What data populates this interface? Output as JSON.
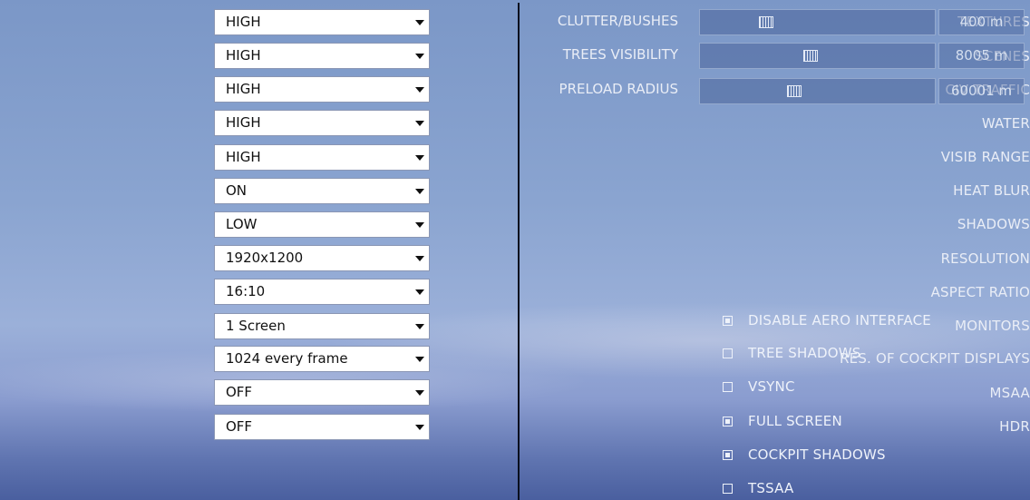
{
  "settings": [
    {
      "label": "TEXTURES",
      "value": "HIGH"
    },
    {
      "label": "SCENES",
      "value": "HIGH"
    },
    {
      "label": "CIV TRAFFIC",
      "value": "HIGH"
    },
    {
      "label": "WATER",
      "value": "HIGH"
    },
    {
      "label": "VISIB RANGE",
      "value": "HIGH"
    },
    {
      "label": "HEAT BLUR",
      "value": "ON"
    },
    {
      "label": "SHADOWS",
      "value": "LOW"
    },
    {
      "label": "RESOLUTION",
      "value": "1920x1200"
    },
    {
      "label": "ASPECT RATIO",
      "value": "16:10"
    },
    {
      "label": "MONITORS",
      "value": "1 Screen"
    },
    {
      "label": "RES. OF COCKPIT DISPLAYS",
      "value": "1024 every frame"
    },
    {
      "label": "MSAA",
      "value": "OFF"
    },
    {
      "label": "HDR",
      "value": "OFF"
    }
  ],
  "sliders": [
    {
      "label": "CLUTTER/BUSHES",
      "value": "400 m",
      "fill": 0.28
    },
    {
      "label": "TREES VISIBILITY",
      "value": "8005 m",
      "fill": 0.47
    },
    {
      "label": "PRELOAD RADIUS",
      "value": "60001 m",
      "fill": 0.4
    }
  ],
  "checkboxes": [
    {
      "label": "DISABLE AERO INTERFACE",
      "checked": true
    },
    {
      "label": "TREE SHADOWS",
      "checked": false
    },
    {
      "label": "VSYNC",
      "checked": false
    },
    {
      "label": "FULL SCREEN",
      "checked": true
    },
    {
      "label": "COCKPIT SHADOWS",
      "checked": true
    },
    {
      "label": "TSSAA",
      "checked": false
    }
  ],
  "colors": {
    "text": "#e9edf6",
    "dropdown_bg": "#ffffff",
    "divider": "#0a0f1e"
  }
}
